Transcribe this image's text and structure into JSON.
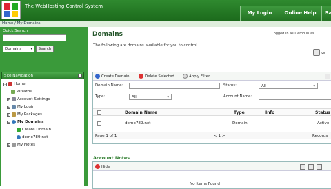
{
  "app": {
    "title": "The WebHosting Control System"
  },
  "top_tabs": [
    {
      "label": "My Login"
    },
    {
      "label": "Online Help"
    },
    {
      "label": "Sa"
    }
  ],
  "breadcrumb": "Home  /  My Domains",
  "quick_search": {
    "label": "Quick Search",
    "input_value": "",
    "select_value": "Domains",
    "button": "Search"
  },
  "site_nav": {
    "header": "Site Navigation",
    "items": [
      {
        "label": "Home"
      },
      {
        "label": "Wizards"
      },
      {
        "label": "Account Settings"
      },
      {
        "label": "My Login"
      },
      {
        "label": "My Packages"
      },
      {
        "label": "My Domains"
      },
      {
        "label": "Create Domain"
      },
      {
        "label": "demo789.net"
      },
      {
        "label": "My Notes"
      }
    ]
  },
  "main": {
    "title": "Domains",
    "logged_in": "Logged in as Demo in as ...",
    "intro": "The following are domains available for you to control.",
    "settings_label": "Se"
  },
  "grid": {
    "toolbar": {
      "create": "Create Domain",
      "delete": "Delete Selected",
      "filter": "Apply Filter"
    },
    "filters": {
      "domain_name_label": "Domain Name:",
      "status_label": "Status:",
      "status_value": "All",
      "type_label": "Type:",
      "type_value": "All",
      "account_name_label": "Account Name:"
    },
    "columns": [
      "Domain Name",
      "Type",
      "Info",
      "Status"
    ],
    "rows": [
      {
        "domain": "demo789.net",
        "type": "Domain",
        "info": "",
        "status": "Active"
      }
    ],
    "pager": {
      "page": "Page 1 of 1",
      "nav": "< 1 >",
      "records": "Records"
    }
  },
  "notes": {
    "title": "Account Notes",
    "hide": "Hide",
    "empty": "No Items Found"
  },
  "colors": {
    "brand_green": "#2f8a2f",
    "panel_border": "#99bbbb"
  }
}
